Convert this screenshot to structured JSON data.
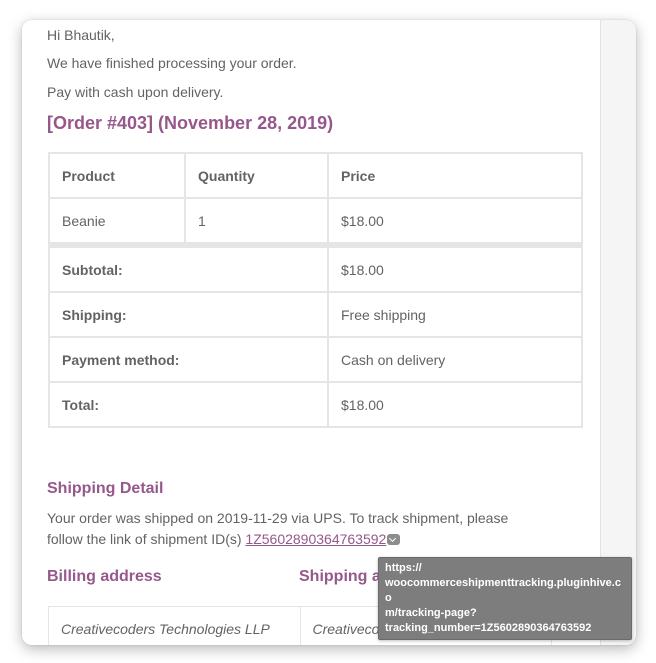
{
  "email": {
    "greeting": "Hi Bhautik,",
    "intro": "We have finished processing your order.",
    "payment_note": "Pay with cash upon delivery.",
    "order_heading": "[Order #403] (November 28, 2019)",
    "order_table": {
      "headers": [
        "Product",
        "Quantity",
        "Price"
      ],
      "items": [
        {
          "product": "Beanie",
          "quantity": "1",
          "price": "$18.00"
        }
      ],
      "totals": [
        {
          "label": "Subtotal:",
          "value": "$18.00"
        },
        {
          "label": "Shipping:",
          "value": "Free shipping"
        },
        {
          "label": "Payment method:",
          "value": "Cash on delivery"
        },
        {
          "label": "Total:",
          "value": "$18.00"
        }
      ]
    },
    "shipping_detail": {
      "heading": "Shipping Detail",
      "text": "Your order was shipped on 2019-11-29 via UPS. To track shipment, please follow the link of shipment ID(s) ",
      "tracking_id": "1Z5602890364763592"
    },
    "billing_heading": "Billing address",
    "shipping_heading": "Shipping address",
    "billing_company": "Creativecoders Technologies LLP",
    "shipping_company": "Creativecoders Technologies LLP"
  },
  "tooltip": {
    "lines": [
      "https://",
      "woocommerceshipmenttracking.pluginhive.co",
      "m/tracking-page?",
      "tracking_number=1Z5602890364763592"
    ]
  },
  "colors": {
    "accent": "#96588a",
    "text": "#636363",
    "border": "#e5e5e5",
    "tooltip_bg": "#7d7d7d"
  }
}
